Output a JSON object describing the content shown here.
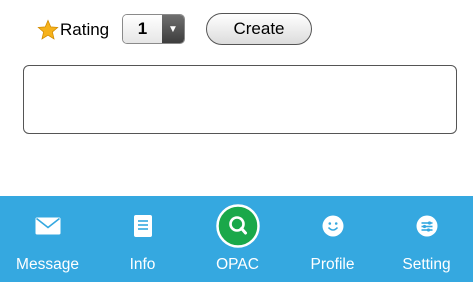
{
  "rating": {
    "label": "Rating",
    "selected_value": "1",
    "star_color": "#f6b21b"
  },
  "create_button": {
    "label": "Create"
  },
  "comment_box": {
    "value": ""
  },
  "tabbar": {
    "background": "#35a8e0",
    "active_color": "#1aa84a",
    "tabs": [
      {
        "label": "Message",
        "icon": "envelope-icon"
      },
      {
        "label": "Info",
        "icon": "document-icon"
      },
      {
        "label": "OPAC",
        "icon": "search-icon",
        "active": true
      },
      {
        "label": "Profile",
        "icon": "smiley-icon"
      },
      {
        "label": "Setting",
        "icon": "sliders-icon"
      }
    ]
  }
}
